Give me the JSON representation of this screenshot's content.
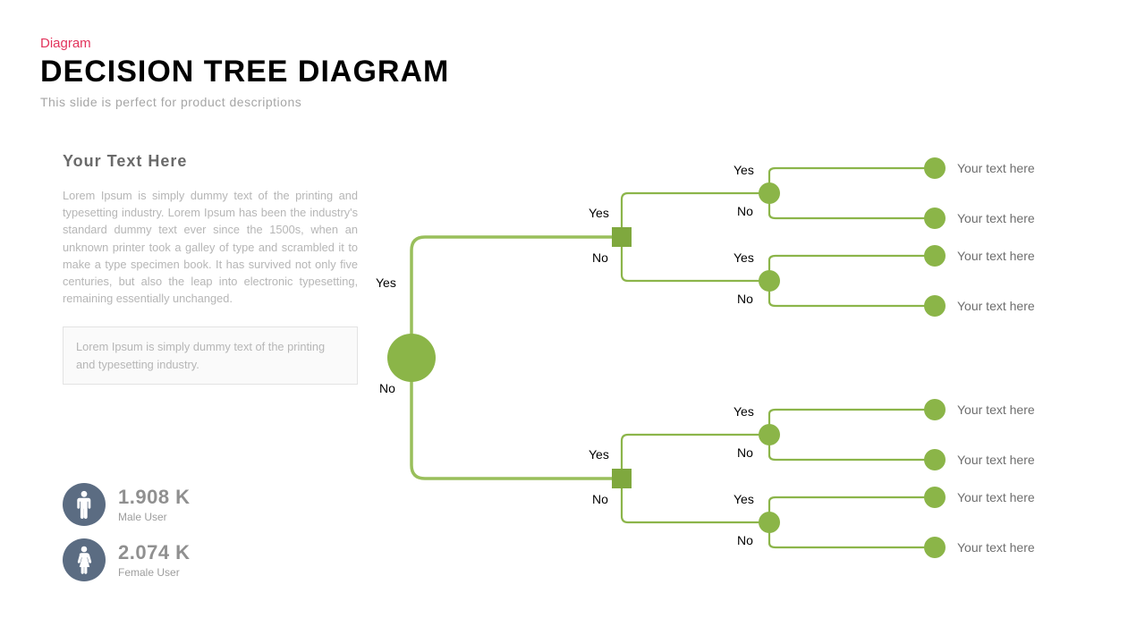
{
  "header": {
    "badge": "Diagram",
    "title": "DECISION TREE DIAGRAM",
    "subtitle": "This slide is perfect for product descriptions"
  },
  "sidebar": {
    "heading": "Your Text Here",
    "body": "Lorem Ipsum is simply dummy text of the printing and typesetting industry. Lorem Ipsum has been the industry's standard dummy text ever since the 1500s, when an unknown printer took a galley of type and scrambled it to make a type specimen book. It has survived not only five centuries, but also the leap into electronic typesetting, remaining essentially unchanged.",
    "callout": "Lorem Ipsum is simply dummy text of the printing and typesetting industry."
  },
  "stats": [
    {
      "icon": "male-icon",
      "value": "1.908 K",
      "label": "Male User"
    },
    {
      "icon": "female-icon",
      "value": "2.074 K",
      "label": "Female User"
    }
  ],
  "tree": {
    "labels": {
      "yes": "Yes",
      "no": "No"
    },
    "leaves": [
      "Your text here",
      "Your text here",
      "Your text here",
      "Your text here",
      "Your text here",
      "Your text here",
      "Your text here",
      "Your text here"
    ]
  },
  "colors": {
    "accent": "#8cb54a",
    "badge": "#e2335b",
    "statIcon": "#5b6c82"
  }
}
